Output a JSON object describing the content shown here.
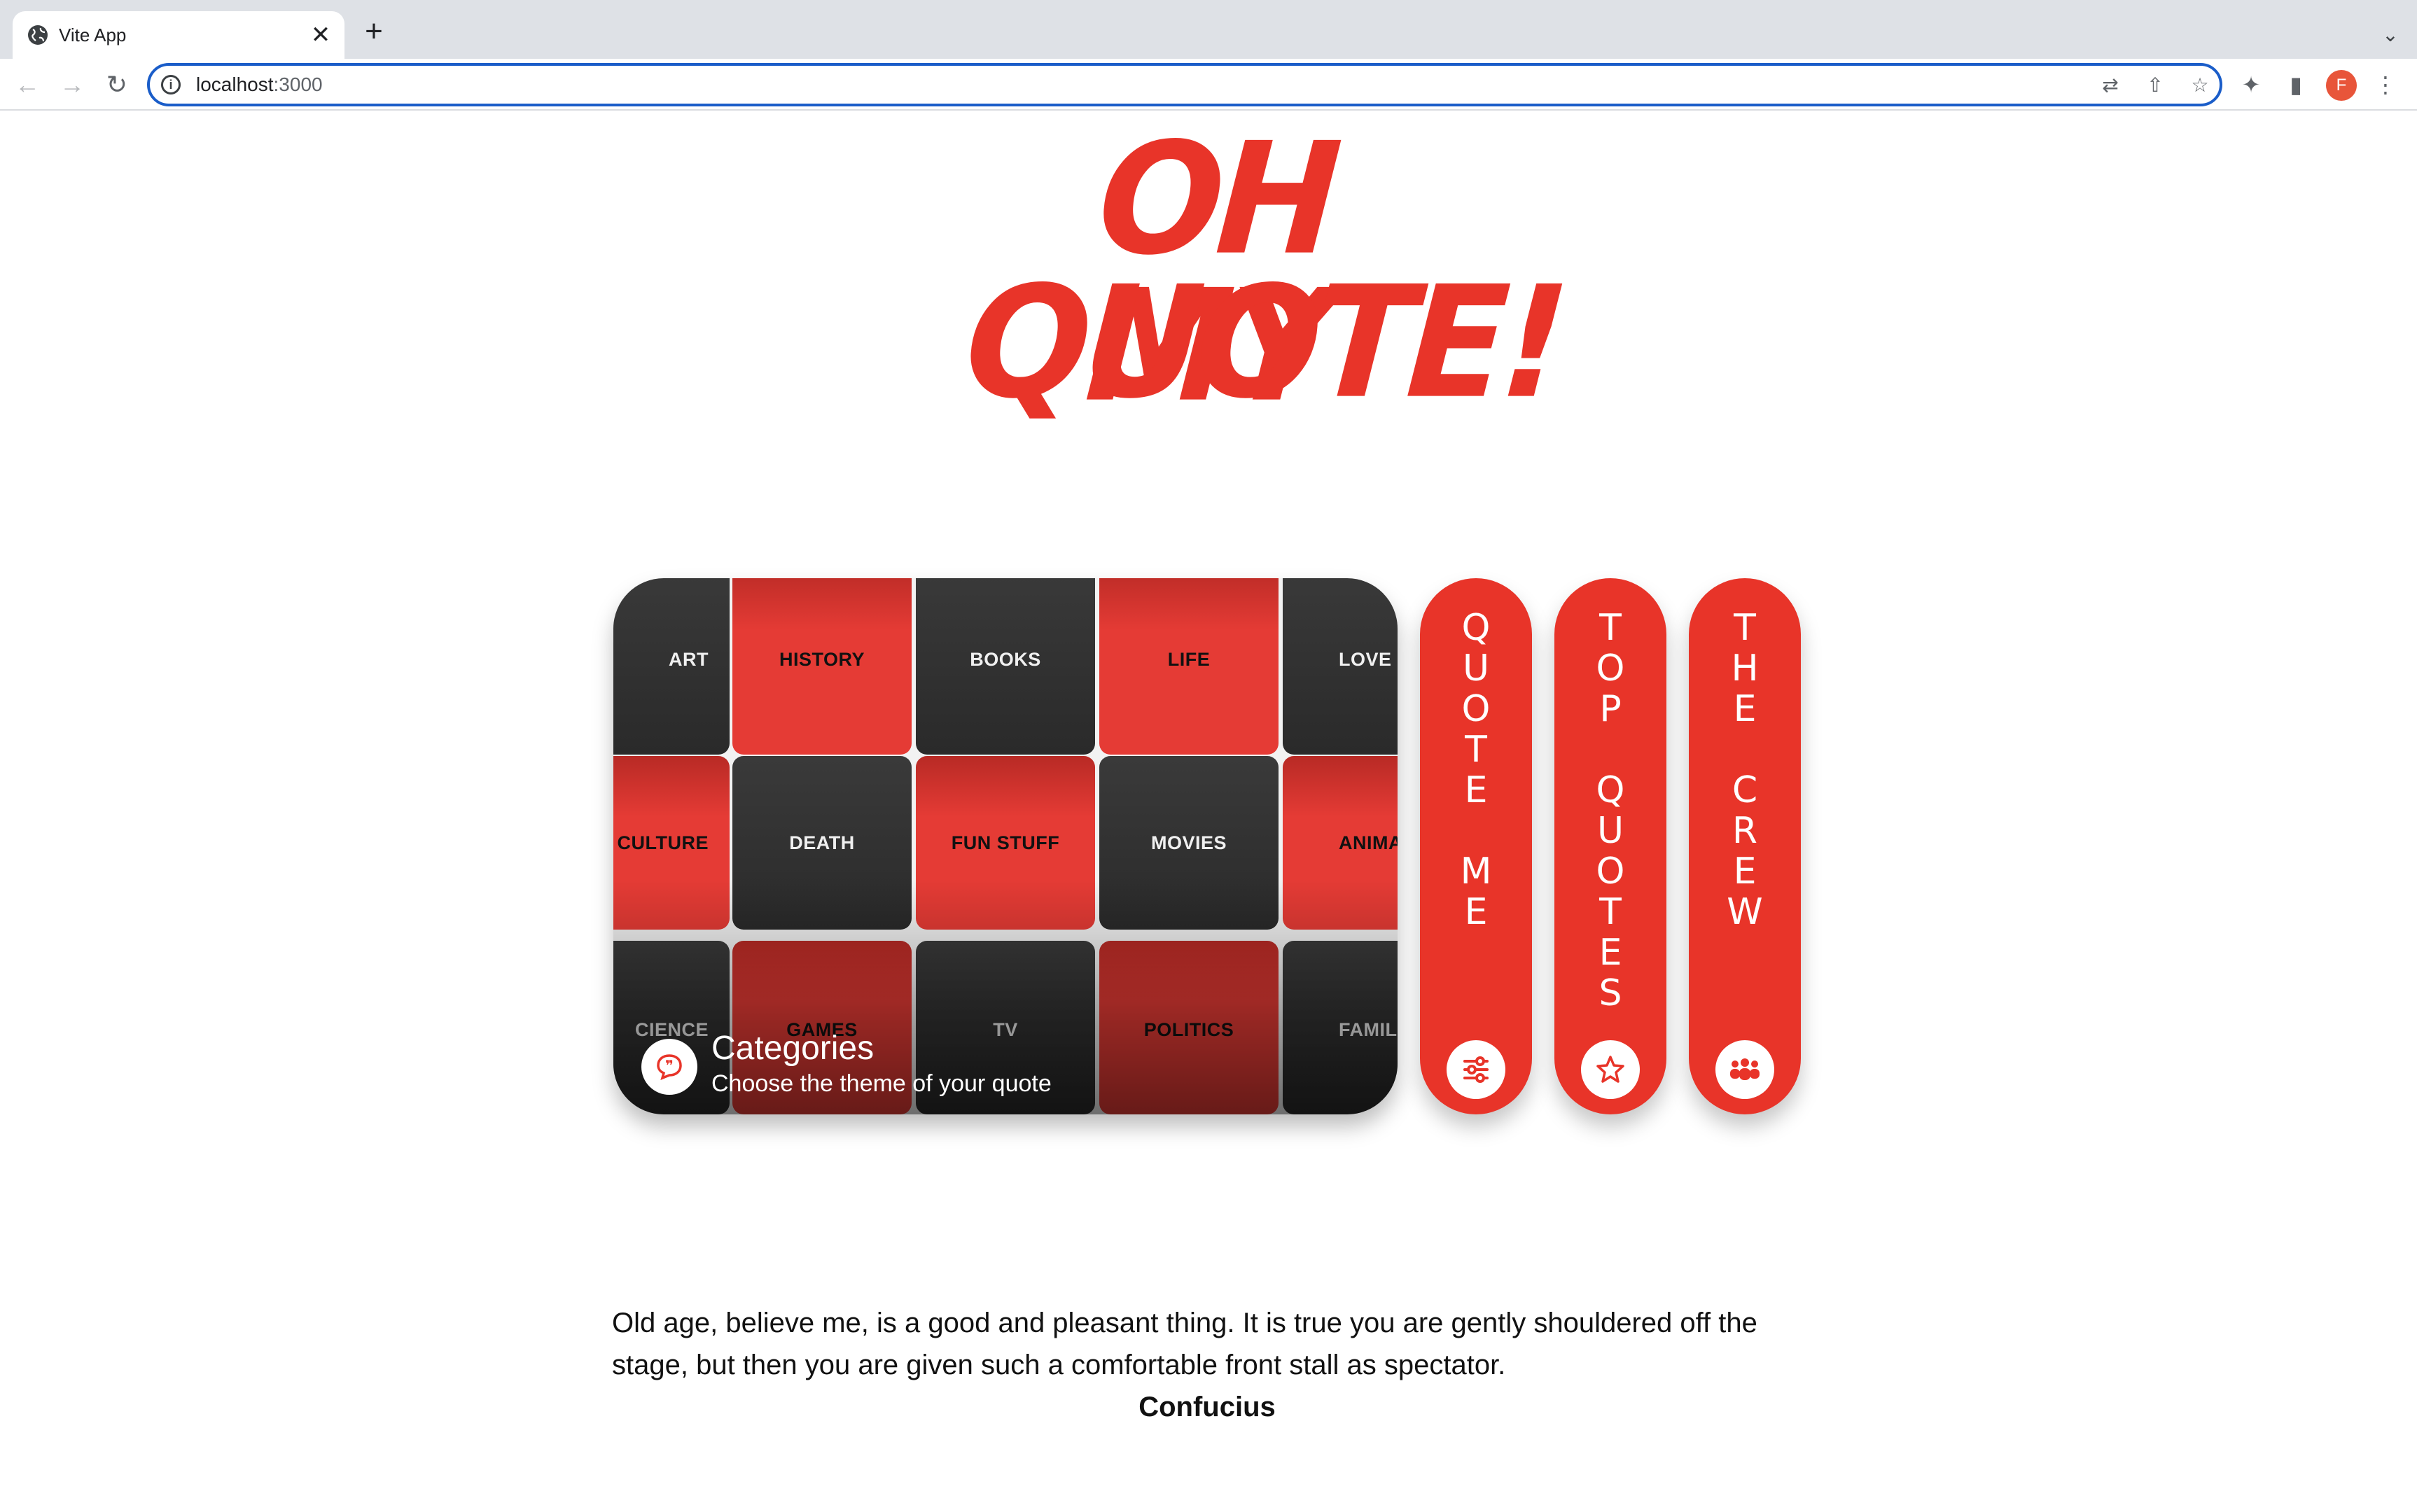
{
  "browser": {
    "tab_title": "Vite App",
    "tab_close": "✕",
    "new_tab": "+",
    "tab_search": "⌄",
    "url_host": "localhost",
    "url_port": ":3000",
    "profile_initial": "F"
  },
  "app": {
    "logo_line1": "OH MY",
    "logo_line2": "QUOTE!",
    "categories_card": {
      "title": "Categories",
      "subtitle": "Choose the theme of your quote",
      "tiles": [
        {
          "label": "ART",
          "color": "dark"
        },
        {
          "label": "HISTORY",
          "color": "red"
        },
        {
          "label": "BOOKS",
          "color": "dark"
        },
        {
          "label": "LIFE",
          "color": "red"
        },
        {
          "label": "LOVE",
          "color": "dark"
        },
        {
          "label": "CULTURE",
          "color": "red"
        },
        {
          "label": "DEATH",
          "color": "dark"
        },
        {
          "label": "FUN STUFF",
          "color": "red"
        },
        {
          "label": "MOVIES",
          "color": "dark"
        },
        {
          "label": "ANIMA",
          "color": "red"
        },
        {
          "label": "CIENCE",
          "color": "dark"
        },
        {
          "label": "GAMES",
          "color": "red"
        },
        {
          "label": "TV",
          "color": "dark"
        },
        {
          "label": "POLITICS",
          "color": "red"
        },
        {
          "label": "FAMIL",
          "color": "dark"
        }
      ]
    },
    "nav_cards": [
      {
        "label": "QUOTE ME",
        "letters": [
          "Q",
          "U",
          "O",
          "T",
          "E",
          " ",
          "M",
          "E"
        ],
        "icon": "sliders-icon"
      },
      {
        "label": "TOP QUOTES",
        "letters": [
          "T",
          "O",
          "P",
          " ",
          "Q",
          "U",
          "O",
          "T",
          "E",
          "S"
        ],
        "icon": "star-icon"
      },
      {
        "label": "THE CREW",
        "letters": [
          "T",
          "H",
          "E",
          " ",
          "C",
          "R",
          "E",
          "W"
        ],
        "icon": "people-icon"
      }
    ],
    "quote": {
      "text": "Old age, believe me, is a good and pleasant thing. It is true you are gently shouldered off the stage, but then you are given such a comfortable front stall as spectator.",
      "author": "Confucius"
    },
    "colors": {
      "accent": "#e83429",
      "dark_tile": "#333333"
    }
  }
}
